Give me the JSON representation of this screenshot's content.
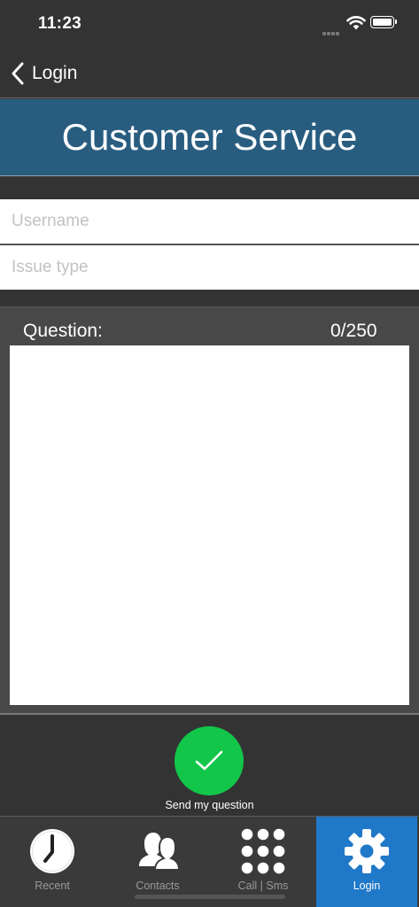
{
  "status_bar": {
    "time": "11:23"
  },
  "nav": {
    "back_label": "Login"
  },
  "header": {
    "title": "Customer Service"
  },
  "form": {
    "username_placeholder": "Username",
    "issue_type_placeholder": "Issue type",
    "question_label": "Question:",
    "question_counter": "0/250",
    "question_value": ""
  },
  "send": {
    "label": "Send my question"
  },
  "tabs": [
    {
      "label": "Recent",
      "icon": "clock-icon"
    },
    {
      "label": "Contacts",
      "icon": "contacts-icon"
    },
    {
      "label": "Call | Sms",
      "icon": "dialpad-icon"
    },
    {
      "label": "Login",
      "icon": "gear-icon",
      "selected": true
    }
  ],
  "colors": {
    "background": "#333333",
    "banner": "#285d80",
    "send_button": "#12c64a",
    "active_tab": "#1f78c8"
  }
}
